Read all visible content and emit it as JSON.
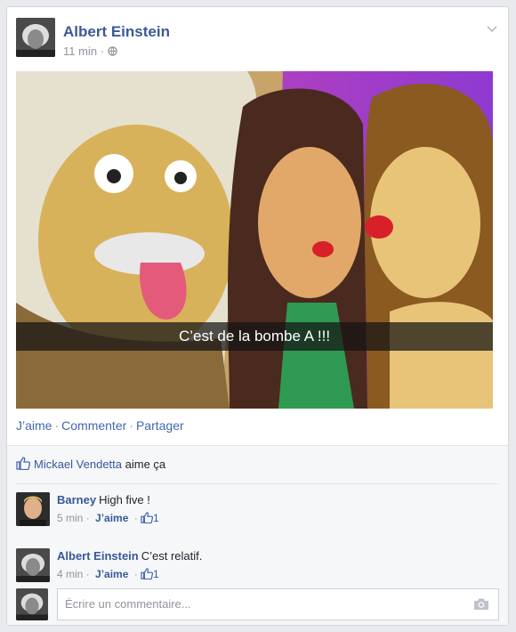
{
  "post": {
    "author": "Albert Einstein",
    "time": "11 min",
    "privacy_icon": "globe-icon",
    "menu_icon": "chevron-down-icon",
    "photo_caption": "C’est de la bombe A !!!"
  },
  "actions": {
    "like": "J’aime",
    "comment": "Commenter",
    "share": "Partager"
  },
  "likes": {
    "icon": "thumbs-up-icon",
    "who": "Mickael Vendetta",
    "text": "aime ça"
  },
  "comments": [
    {
      "author": "Barney",
      "text": "High five !",
      "time": "5 min",
      "like_label": "J’aime",
      "like_count": "1"
    },
    {
      "author": "Albert Einstein",
      "text": "C’est relatif.",
      "time": "4 min",
      "like_label": "J’aime",
      "like_count": "1"
    }
  ],
  "composer": {
    "placeholder": "Écrire un commentaire...",
    "icon": "camera-icon"
  },
  "colors": {
    "link": "#3b5998",
    "background": "#e9eaed"
  }
}
